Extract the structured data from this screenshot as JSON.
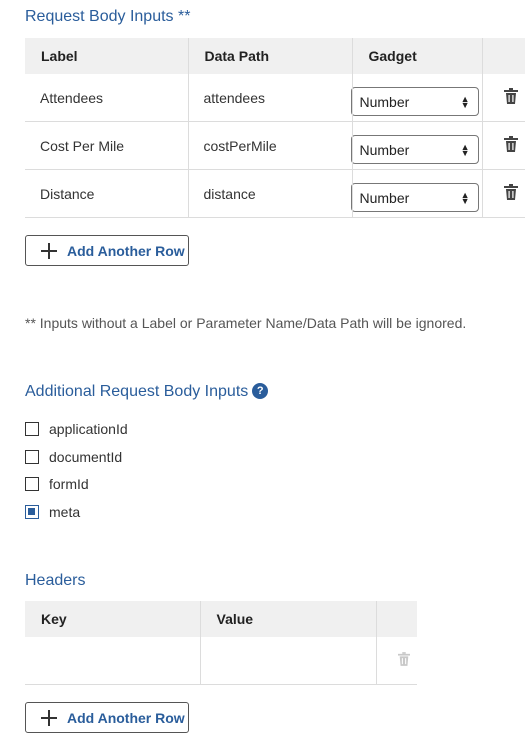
{
  "request_body": {
    "title": "Request Body Inputs **",
    "columns": {
      "label": "Label",
      "data_path": "Data Path",
      "gadget": "Gadget"
    },
    "rows": [
      {
        "label": "Attendees",
        "data_path": "attendees",
        "gadget": "Number"
      },
      {
        "label": "Cost Per Mile",
        "data_path": "costPerMile",
        "gadget": "Number"
      },
      {
        "label": "Distance",
        "data_path": "distance",
        "gadget": "Number"
      }
    ],
    "add_row_label": "Add Another Row",
    "note": "** Inputs without a Label or Parameter Name/Data Path will be ignored."
  },
  "additional_inputs": {
    "title": "Additional Request Body Inputs",
    "help_icon": "?",
    "options": [
      {
        "label": "applicationId",
        "checked": false
      },
      {
        "label": "documentId",
        "checked": false
      },
      {
        "label": "formId",
        "checked": false
      },
      {
        "label": "meta",
        "checked": true
      }
    ]
  },
  "headers": {
    "title": "Headers",
    "columns": {
      "key": "Key",
      "value": "Value"
    },
    "rows": [
      {
        "key": "",
        "value": ""
      }
    ],
    "add_row_label": "Add Another Row"
  },
  "colors": {
    "accent": "#2a5d9b",
    "header_bg": "#f0f0f0",
    "border": "#dcdcdc"
  }
}
